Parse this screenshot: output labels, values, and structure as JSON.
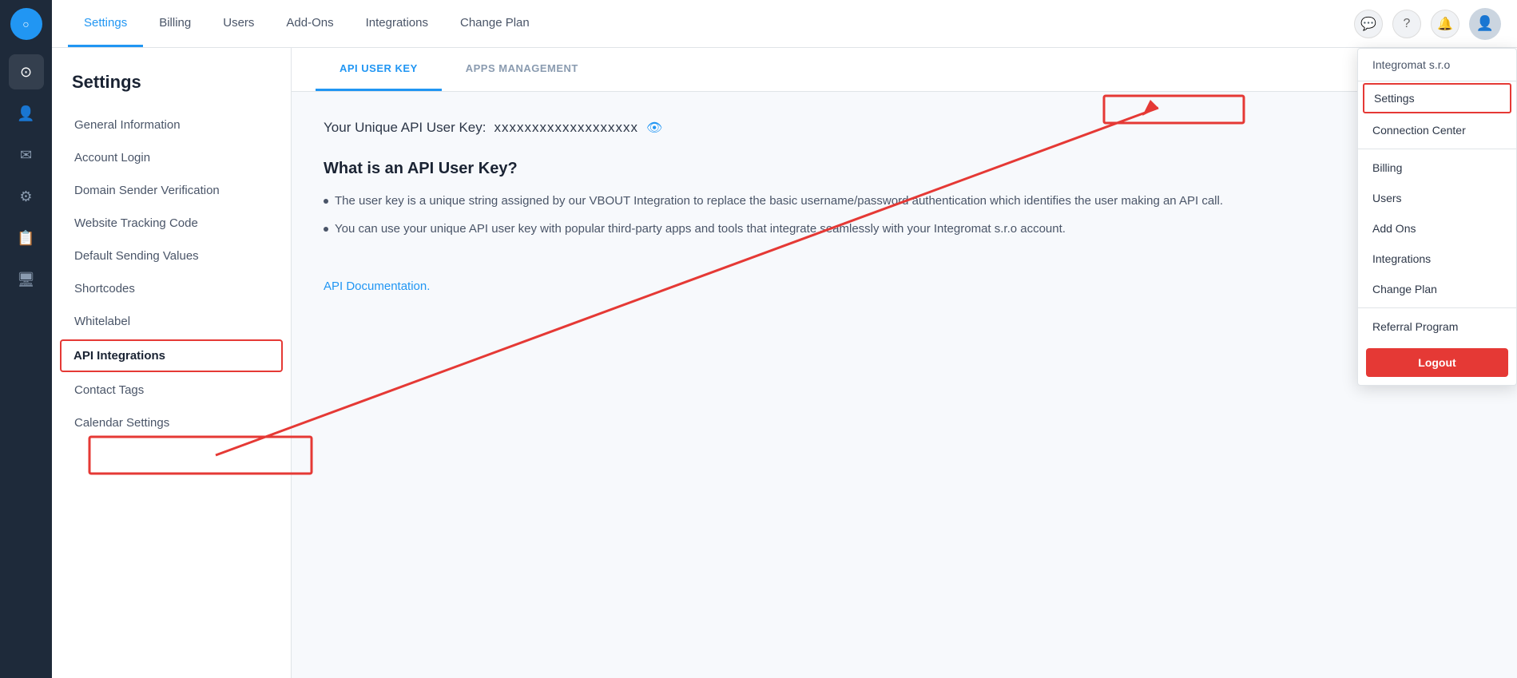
{
  "sidebar_icons": {
    "logo": "○",
    "items": [
      {
        "name": "dashboard",
        "icon": "⊙",
        "active": false
      },
      {
        "name": "contacts",
        "icon": "👤",
        "active": false
      },
      {
        "name": "email",
        "icon": "✉",
        "active": false
      },
      {
        "name": "automation",
        "icon": "⚙",
        "active": false
      },
      {
        "name": "forms",
        "icon": "📋",
        "active": false
      },
      {
        "name": "pages",
        "icon": "🖥",
        "active": false
      }
    ]
  },
  "top_nav": {
    "tabs": [
      {
        "label": "Settings",
        "active": true
      },
      {
        "label": "Billing",
        "active": false
      },
      {
        "label": "Users",
        "active": false
      },
      {
        "label": "Add-Ons",
        "active": false
      },
      {
        "label": "Integrations",
        "active": false
      },
      {
        "label": "Change Plan",
        "active": false
      }
    ]
  },
  "settings_page": {
    "title": "Settings",
    "menu_items": [
      {
        "label": "General Information",
        "active": false
      },
      {
        "label": "Account Login",
        "active": false
      },
      {
        "label": "Domain Sender Verification",
        "active": false
      },
      {
        "label": "Website Tracking Code",
        "active": false
      },
      {
        "label": "Default Sending Values",
        "active": false
      },
      {
        "label": "Shortcodes",
        "active": false
      },
      {
        "label": "Whitelabel",
        "active": false
      },
      {
        "label": "API Integrations",
        "active": true,
        "highlighted": true
      },
      {
        "label": "Contact Tags",
        "active": false
      },
      {
        "label": "Calendar Settings",
        "active": false
      }
    ]
  },
  "content_tabs": [
    {
      "label": "API USER KEY",
      "active": true
    },
    {
      "label": "APPS MANAGEMENT",
      "active": false
    }
  ],
  "api_section": {
    "key_prefix": "Your Unique API User Key:",
    "key_value": "xxxxxxxxxxxxxxxxxxx",
    "what_is_title": "What is an API User Key?",
    "bullets": [
      "The user key is a unique string assigned by our VBOUT Integration to replace the basic username/password authentication which identifies the user making an API call.",
      "You can use your unique API user key with popular third-party apps and tools that integrate seamlessly with your Integromat s.r.o account."
    ],
    "doc_link": "API Documentation."
  },
  "dropdown": {
    "company": "Integromat s.r.o",
    "items": [
      {
        "label": "Settings",
        "highlighted": true
      },
      {
        "label": "Connection Center"
      },
      {
        "label": "Billing"
      },
      {
        "label": "Users"
      },
      {
        "label": "Add Ons"
      },
      {
        "label": "Integrations"
      },
      {
        "label": "Change Plan"
      },
      {
        "label": "Referral Program"
      }
    ],
    "logout_label": "Logout"
  }
}
